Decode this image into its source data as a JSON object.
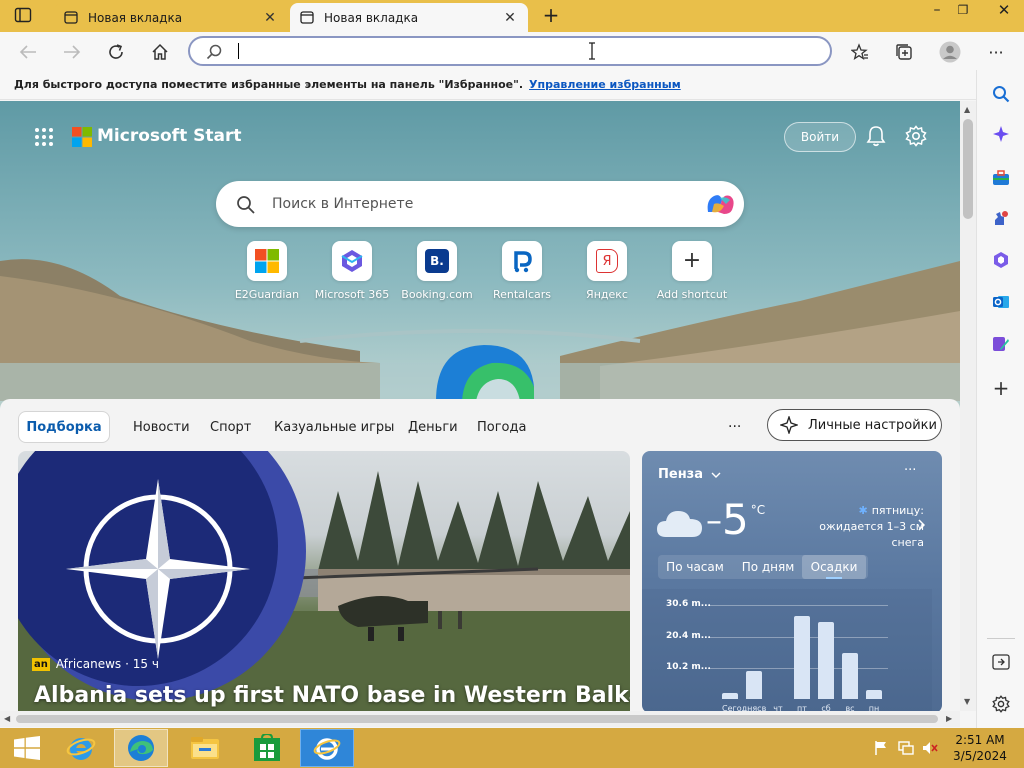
{
  "browser": {
    "tabs": [
      {
        "label": "Новая вкладка",
        "active": false
      },
      {
        "label": "Новая вкладка",
        "active": true
      }
    ],
    "address_value": "",
    "favorites_bar": {
      "text": "Для быстрого доступа поместите избранные элементы на панель \"Избранное\".",
      "link": "Управление избранным"
    }
  },
  "page": {
    "brand": "Microsoft Start",
    "signin_label": "Войти",
    "search_placeholder": "Поиск в Интернете",
    "shortcuts": [
      {
        "label": "E2Guardian",
        "icon": "windows-logo-icon"
      },
      {
        "label": "Microsoft 365",
        "icon": "microsoft365-icon"
      },
      {
        "label": "Booking.com",
        "icon": "booking-icon",
        "glyph": "B."
      },
      {
        "label": "Rentalcars",
        "icon": "rentalcars-icon"
      },
      {
        "label": "Яндекс",
        "icon": "yandex-icon",
        "glyph": "Я"
      },
      {
        "label": "Add shortcut",
        "icon": "plus-icon",
        "glyph": "+"
      }
    ],
    "feed_tabs": [
      "Подборка",
      "Новости",
      "Спорт",
      "Казуальные игры",
      "Деньги",
      "Погода"
    ],
    "more_label": "···",
    "personalize_label": "Личные настройки",
    "hero": {
      "source": "Africanews",
      "source_logo": "an",
      "age": "· 15 ч",
      "title": "Albania sets up first NATO base in Western Balkans"
    },
    "weather": {
      "city": "Пенза",
      "temp": "5",
      "temp_sign": "–",
      "unit": "°C",
      "forecast_line1": "пятницу:",
      "forecast_line2": "ожидается 1–3 см",
      "forecast_line3": "снега",
      "tabs": [
        "По часам",
        "По дням",
        "Осадки"
      ],
      "active_tab": "Осадки",
      "more": "···"
    }
  },
  "chart_data": {
    "type": "bar",
    "title": "",
    "categories": [
      "Сегодня",
      "вс",
      "чт",
      "пт",
      "сб",
      "вс",
      "пн"
    ],
    "category_labels_printed": [
      "Сегоднясв",
      "чт",
      "пт",
      "сб",
      "вс",
      "пн"
    ],
    "values": [
      2,
      9,
      0,
      27,
      25,
      15,
      3
    ],
    "yticks": [
      "30.6 m...",
      "20.4 m...",
      "10.2 m..."
    ],
    "ytick_values": [
      30.6,
      20.4,
      10.2
    ],
    "ylim": [
      0,
      32
    ],
    "grid": true,
    "colors": {
      "bar": "#d9e5f5"
    }
  },
  "taskbar": {
    "time": "2:51 AM",
    "date": "3/5/2024",
    "items": [
      "ie-icon",
      "edge-icon",
      "file-explorer-icon",
      "store-icon",
      "ie-app-icon"
    ]
  },
  "colors": {
    "titlebar": "#e9bf4a",
    "taskbar": "#d5a941",
    "accent": "#0b5cad",
    "link": "#0b57c1"
  }
}
